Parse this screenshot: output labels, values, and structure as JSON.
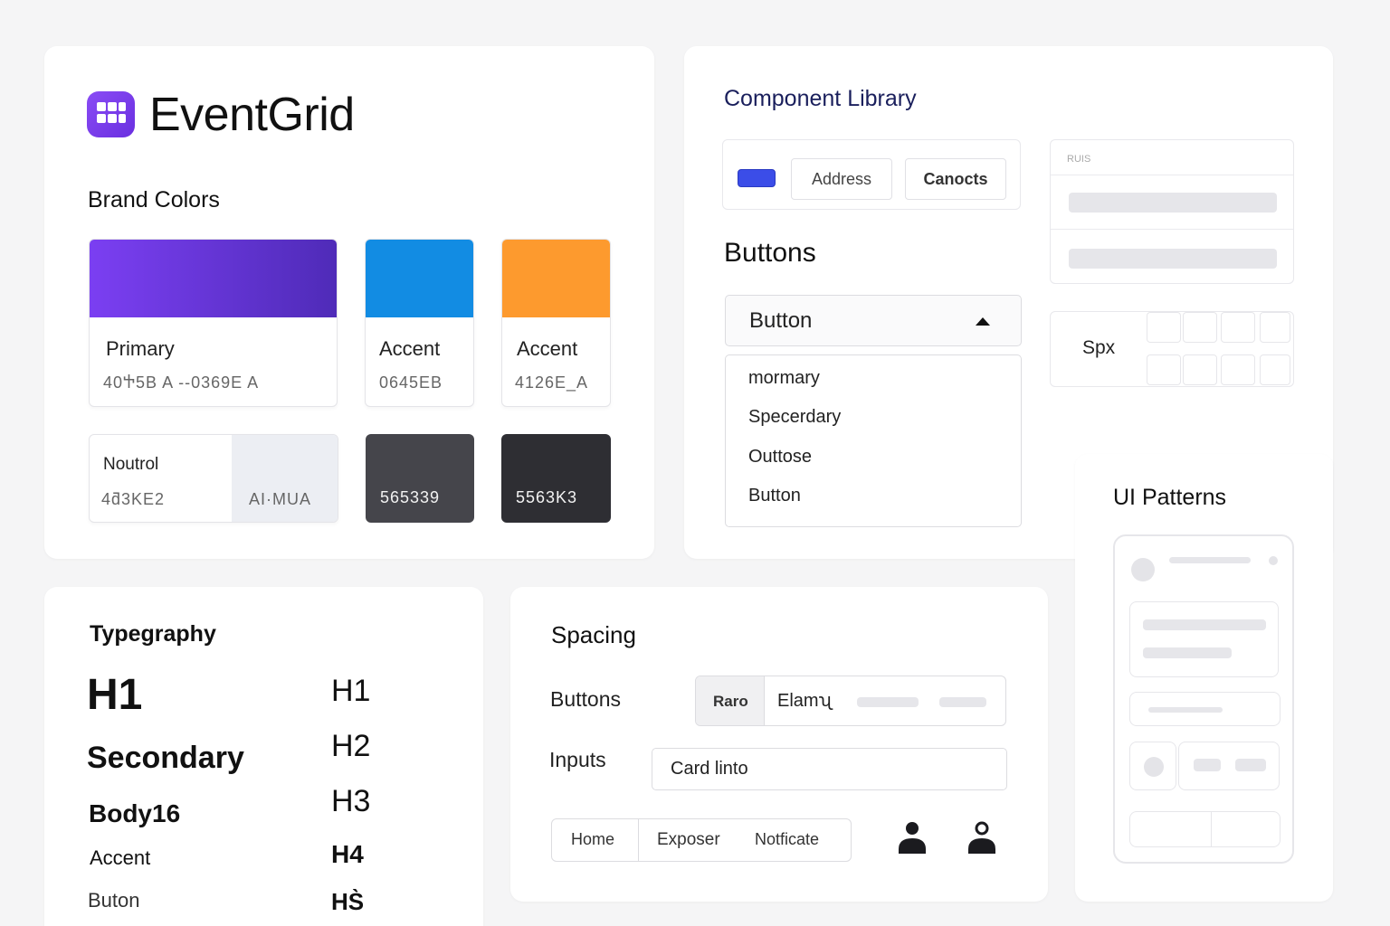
{
  "brand": {
    "app_name": "EventGrid",
    "colors_title": "Brand Colors",
    "primary": {
      "name": "Primary",
      "hex": "40Ⴕ5B A  --0369E A",
      "gradient_from": "#7b3ff2",
      "gradient_to": "#4f2bb8"
    },
    "accent_blue": {
      "name": "Accent",
      "hex": "0645EB",
      "color": "#128ce3"
    },
    "accent_orange": {
      "name": "Accent",
      "hex": "4126E_A",
      "color": "#fd9a2e"
    },
    "neutral": {
      "name": "Noutrol",
      "hex": "4ƌ3KE2",
      "alt": "AI·MUA"
    },
    "dark1": {
      "hex": "565339",
      "color": "#45454b"
    },
    "dark2": {
      "hex": "5563K3",
      "color": "#2e2e33"
    }
  },
  "component_library": {
    "title": "Component Library",
    "toolbar": {
      "address_label": "Address",
      "cancel_label": "Canocts",
      "accent": "#3b4de8"
    },
    "side_form_header": "RUIS",
    "buttons_heading": "Buttons",
    "dropdown": {
      "selected": "Button",
      "options": [
        "mormary",
        "Specerdary",
        "Outtose",
        "Button"
      ]
    },
    "spacing_box_label": "Spx"
  },
  "ui_patterns": {
    "title": "UI Patterns"
  },
  "typography": {
    "title": "Typegraphy",
    "samples": [
      "H1",
      "Secondary",
      "Body16",
      "Accent",
      "Buton"
    ],
    "headings": [
      "H1",
      "H2",
      "H3",
      "H4",
      "HS̀"
    ]
  },
  "spacing": {
    "title": "Spacing",
    "buttons_label": "Buttons",
    "button_group": [
      "Raro",
      "Elamʯ"
    ],
    "inputs_label": "Inputs",
    "input_value": "Card linto",
    "tabs": [
      "Home",
      "Exposer",
      "Notficate"
    ],
    "icons": [
      "user-icon",
      "user-outline-icon"
    ]
  }
}
